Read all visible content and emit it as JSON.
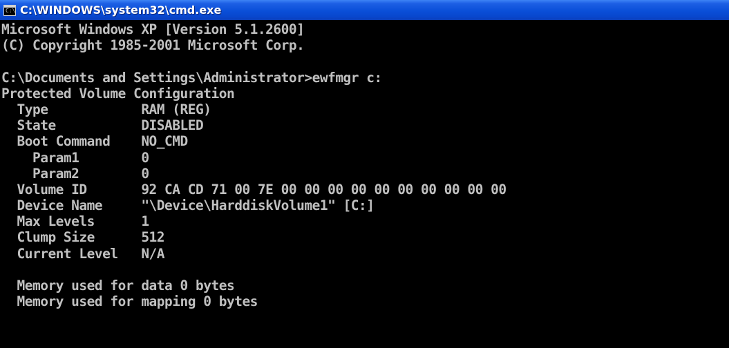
{
  "window": {
    "title": "C:\\WINDOWS\\system32\\cmd.exe",
    "icon_label": "C:\\",
    "icon": "console-icon"
  },
  "colors": {
    "titlebar_gradient_top": "#3d83f5",
    "titlebar_gradient_bottom": "#0846cc",
    "console_background": "#000000",
    "console_text": "#c0c0c0"
  },
  "console": {
    "lines": [
      "Microsoft Windows XP [Version 5.1.2600]",
      "(C) Copyright 1985-2001 Microsoft Corp.",
      "",
      "C:\\Documents and Settings\\Administrator>ewfmgr c:",
      "Protected Volume Configuration",
      "  Type            RAM (REG)",
      "  State           DISABLED",
      "  Boot Command    NO_CMD",
      "    Param1        0",
      "    Param2        0",
      "  Volume ID       92 CA CD 71 00 7E 00 00 00 00 00 00 00 00 00 00",
      "  Device Name     \"\\Device\\HarddiskVolume1\" [C:]",
      "  Max Levels      1",
      "  Clump Size      512",
      "  Current Level   N/A",
      "",
      "  Memory used for data 0 bytes",
      "  Memory used for mapping 0 bytes"
    ]
  }
}
